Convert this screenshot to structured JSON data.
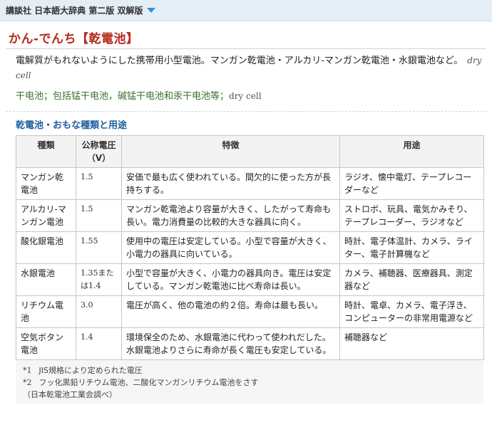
{
  "header": {
    "dictionary": "講談社 日本語大辞典 第二版 双解版"
  },
  "entry": {
    "headword": "かん-でんち【乾電池】",
    "definition": "電解質がもれないようにした携帯用小型電池。マンガン乾電池・アルカリ-マンガン乾電池・水銀電池など。",
    "definition_en": "dry cell",
    "chinese": "干电池；包括锰干电池，碱锰干电池和汞干电池等；",
    "chinese_en": "dry cell"
  },
  "section": {
    "title": "乾電池・おもな種類と用途"
  },
  "table": {
    "headers": [
      "種類",
      "公称電圧（V）",
      "特徴",
      "用途"
    ],
    "rows": [
      [
        "マンガン乾電池",
        "1.5",
        "安価で最も広く使われている。間欠的に使った方が長持ちする。",
        "ラジオ、懐中電灯、テープレコーダーなど"
      ],
      [
        "アルカリ-マンガン電池",
        "1.5",
        "マンガン乾電池より容量が大きく、したがって寿命も長い。電力消費量の比較的大きな器具に向く。",
        "ストロボ、玩具、電気かみそり、テープレコーダー、ラジオなど"
      ],
      [
        "酸化銀電池",
        "1.55",
        "使用中の電圧は安定している。小型で容量が大きく、小電力の器具に向いている。",
        "時計、電子体温計、カメラ、ライター、電子計算機など"
      ],
      [
        "水銀電池",
        "1.35または1.4",
        "小型で容量が大きく、小電力の器具向き。電圧は安定している。マンガン乾電池に比べ寿命は長い。",
        "カメラ、補聴器、医療器具、測定器など"
      ],
      [
        "リチウム電池",
        "3.0",
        "電圧が高く、他の電池の約２倍。寿命は最も長い。",
        "時計、電卓、カメラ、電子浮き、コンピューターの非常用電源など"
      ],
      [
        "空気ボタン電池",
        "1.4",
        "環境保全のため、水銀電池に代わって使われだした。水銀電池よりさらに寿命が長く電圧も安定している。",
        "補聴器など"
      ]
    ]
  },
  "notes": {
    "n1_mark": "*1",
    "n1": "JIS規格により定められた電圧",
    "n2_mark": "*2",
    "n2": "フッ化黒鉛リチウム電池、二酸化マンガンリチウム電池をさす",
    "source": "（日本乾電池工業会調べ）"
  },
  "colors": {
    "headword": "#b5281c",
    "section": "#1f5f9c",
    "chinese": "#3d6f2c",
    "caret": "#3a8fd6"
  },
  "icons": {
    "dropdown": "chevron-down-icon"
  }
}
